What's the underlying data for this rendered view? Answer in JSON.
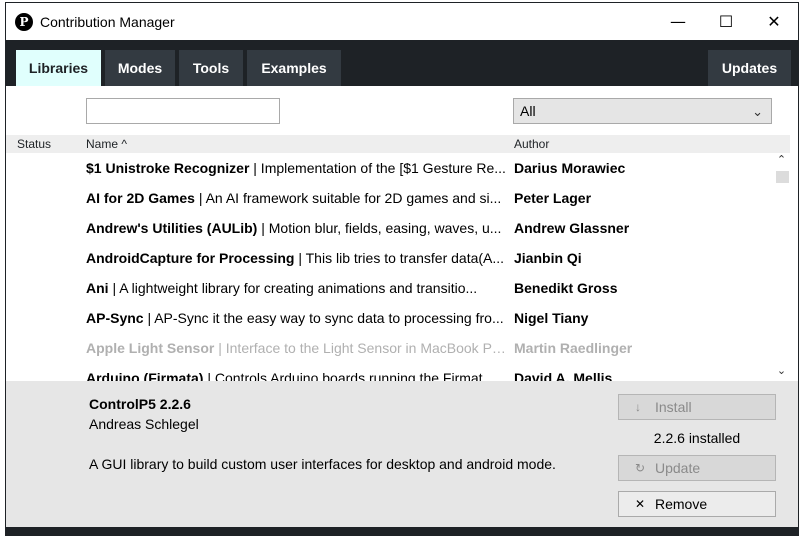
{
  "window": {
    "title": "Contribution Manager",
    "minimize": "—",
    "maximize": "☐",
    "close": "✕"
  },
  "tabs": [
    {
      "label": "Libraries"
    },
    {
      "label": "Modes"
    },
    {
      "label": "Tools"
    },
    {
      "label": "Examples"
    }
  ],
  "updates_tab": "Updates",
  "filter": {
    "value": "",
    "placeholder": ""
  },
  "category": {
    "selected": "All"
  },
  "columns": {
    "status": "Status",
    "name": "Name ^",
    "author": "Author"
  },
  "rows": [
    {
      "name": "$1 Unistroke Recognizer",
      "desc": " | Implementation of the [$1 Gesture Re...",
      "author": "Darius Morawiec"
    },
    {
      "name": "AI for 2D Games",
      "desc": " | An AI framework suitable for 2D games and si...",
      "author": "Peter Lager"
    },
    {
      "name": "Andrew's Utilities (AULib)",
      "desc": " | Motion blur, fields, easing, waves, u...",
      "author": "Andrew Glassner"
    },
    {
      "name": "AndroidCapture for Processing",
      "desc": " | This lib tries to transfer data(A...",
      "author": "Jianbin Qi"
    },
    {
      "name": "Ani",
      "desc": " | A lightweight library for creating animations and transitio...",
      "author": "Benedikt Gross"
    },
    {
      "name": "AP-Sync",
      "desc": " | AP-Sync it the easy way to sync data to processing fro...",
      "author": "Nigel Tiany"
    },
    {
      "name": "Apple Light Sensor",
      "desc": " | Interface to the Light Sensor in MacBook Pr...",
      "author": "Martin Raedlinger"
    },
    {
      "name": "Arduino (Firmata)",
      "desc": " | Controls Arduino boards running the Firmat...",
      "author": "David A. Mellis"
    }
  ],
  "selected": {
    "name": "ControlP5 2.2.6",
    "author": "Andreas Schlegel",
    "description": "A GUI library to build custom user interfaces for desktop and android mode.",
    "installed_text": "2.2.6 installed"
  },
  "buttons": {
    "install": "Install",
    "install_icon": "↓",
    "update": "Update",
    "update_icon": "↻",
    "remove": "Remove",
    "remove_icon": "✕"
  },
  "colors": {
    "dark": "#1e2226",
    "tab": "#333a41",
    "tab_active": "#e0fffd"
  }
}
